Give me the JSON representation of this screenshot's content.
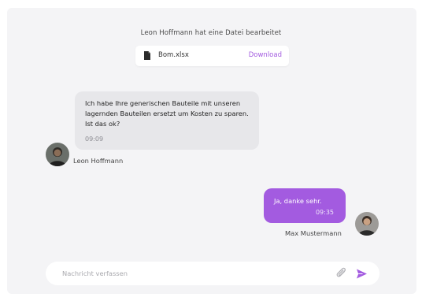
{
  "system_note": {
    "text": "Leon Hoffmann hat eine Datei bearbeitet"
  },
  "file": {
    "name": "Bom.xlsx",
    "action_label": "Download",
    "icon": "document-icon"
  },
  "messages": [
    {
      "sender": "Leon Hoffmann",
      "direction": "incoming",
      "text": "Ich habe Ihre generischen Bauteile mit unseren lagernden Bauteilen ersetzt um Kosten zu sparen. Ist das ok?",
      "time": "09:09"
    },
    {
      "sender": "Max Mustermann",
      "direction": "outgoing",
      "text": "Ja, danke sehr.",
      "time": "09:35"
    }
  ],
  "composer": {
    "placeholder": "Nachricht verfassen",
    "value": "",
    "attach_icon": "paperclip-icon",
    "send_icon": "send-icon"
  },
  "colors": {
    "accent": "#a35be0",
    "panel_background": "#f4f4f6",
    "incoming_bubble": "#e7e7ea"
  }
}
